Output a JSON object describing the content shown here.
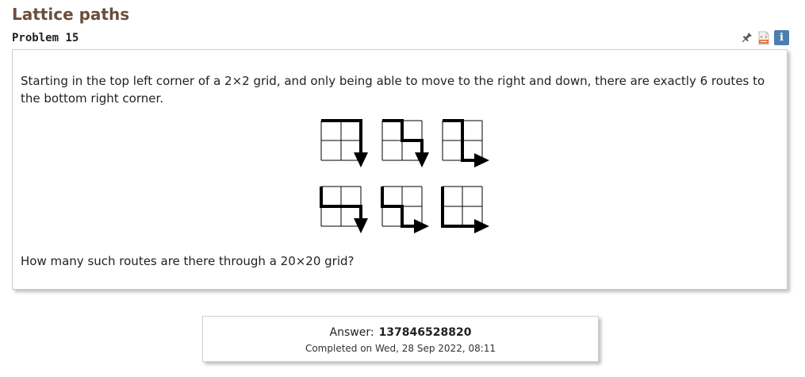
{
  "header": {
    "title": "Lattice paths",
    "problem_label": "Problem 15"
  },
  "toolbar": {
    "icons": [
      "pin-icon",
      "html-file-icon",
      "info-icon"
    ],
    "info_glyph": "i"
  },
  "problem": {
    "intro": "Starting in the top left corner of a 2×2 grid, and only being able to move to the right and down, there are exactly 6 routes to the bottom right corner.",
    "question": "How many such routes are there through a 20×20 grid?",
    "routes": [
      [
        "R",
        "R",
        "D",
        "D"
      ],
      [
        "R",
        "D",
        "R",
        "D"
      ],
      [
        "R",
        "D",
        "D",
        "R"
      ],
      [
        "D",
        "R",
        "R",
        "D"
      ],
      [
        "D",
        "R",
        "D",
        "R"
      ],
      [
        "D",
        "D",
        "R",
        "R"
      ]
    ]
  },
  "answer": {
    "label": "Answer:",
    "value": "137846528820",
    "completed": "Completed on Wed, 28 Sep 2022, 08:11"
  },
  "colors": {
    "title": "#6b4e3d",
    "info_icon": "#4b7fb0",
    "html_icon": "#e8733b"
  }
}
